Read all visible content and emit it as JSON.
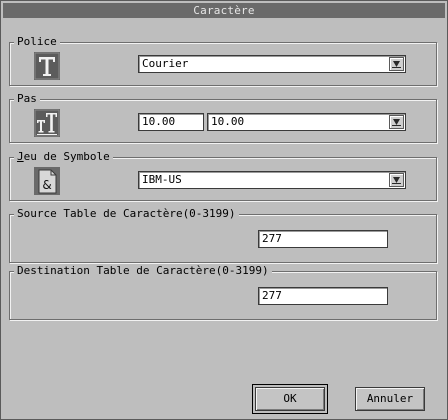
{
  "window": {
    "title": "Caractère"
  },
  "police": {
    "legend": "Police",
    "icon": "font-t-icon",
    "font_value": "Courier"
  },
  "pas": {
    "legend": "Pas",
    "icon": "font-pitch-icon",
    "pitch_a": "10.00",
    "pitch_b": "10.00"
  },
  "jeu": {
    "legend": "Jeu de Symbole",
    "icon": "ampersand-icon",
    "symbol_set": "IBM-US"
  },
  "source": {
    "legend": "Source Table de Caractère(0-3199)",
    "value": "277"
  },
  "destination": {
    "legend": "Destination Table de Caractère(0-3199)",
    "value": "277"
  },
  "buttons": {
    "ok": "OK",
    "cancel": "Annuler"
  },
  "colors": {
    "window_bg": "#bebebe",
    "titlebar_bg": "#6a6a6a",
    "titlebar_text": "#e6e6e6"
  }
}
